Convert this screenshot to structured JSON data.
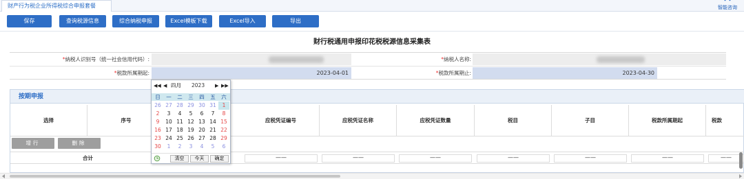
{
  "tab": {
    "title": "财产行为税企业所得税综合申报套餐"
  },
  "help": {
    "label": "智能咨询",
    "icon": "chat-help-icon"
  },
  "toolbar": {
    "buttons": [
      "保存",
      "查询税源信息",
      "综合纳税申报",
      "Excel模板下载",
      "Excel导入",
      "导出"
    ]
  },
  "form": {
    "title": "财行税通用申报印花税税源信息采集表",
    "taxpayer_id_label": "纳税人识别号（统一社会信用代码）:",
    "taxpayer_name_label": "纳税人名称:",
    "period_start_label": "税款所属期起:",
    "period_start_value": "2023-04-01",
    "period_end_label": "税款所属期止:",
    "period_end_value": "2023-04-30",
    "required_mark": "*"
  },
  "section": {
    "title": "按期申报",
    "columns": [
      "选择",
      "序号",
      "应税凭证编号",
      "应税凭证名称",
      "应税凭证数量",
      "税目",
      "子目",
      "税款所属期起",
      "税款"
    ],
    "add_row_label": "增行",
    "delete_label": "删除",
    "total_label": "合计",
    "dash": "——"
  },
  "datepicker": {
    "nav_prev_year": "◀◀",
    "nav_prev_month": "◀",
    "nav_next_month": "▶",
    "nav_next_year": "▶▶",
    "month": "四月",
    "year": "2023",
    "weekdays": [
      "日",
      "一",
      "二",
      "三",
      "四",
      "五",
      "六"
    ],
    "weeks": [
      [
        "26",
        "27",
        "28",
        "29",
        "30",
        "31",
        "1"
      ],
      [
        "2",
        "3",
        "4",
        "5",
        "6",
        "7",
        "8"
      ],
      [
        "9",
        "10",
        "11",
        "12",
        "13",
        "14",
        "15"
      ],
      [
        "16",
        "17",
        "18",
        "19",
        "20",
        "21",
        "22"
      ],
      [
        "23",
        "24",
        "25",
        "26",
        "27",
        "28",
        "29"
      ],
      [
        "30",
        "1",
        "2",
        "3",
        "4",
        "5",
        "6"
      ]
    ],
    "footer": {
      "clear": "清空",
      "today": "今天",
      "ok": "确定"
    }
  },
  "colors": {
    "primary": "#2e6ec6",
    "header_bg": "#eaf0f8",
    "input_blue": "#d2dcef",
    "weekday_bg": "#cfe8ef",
    "weekend": "#e54646",
    "other_month": "#8a8fe0"
  }
}
